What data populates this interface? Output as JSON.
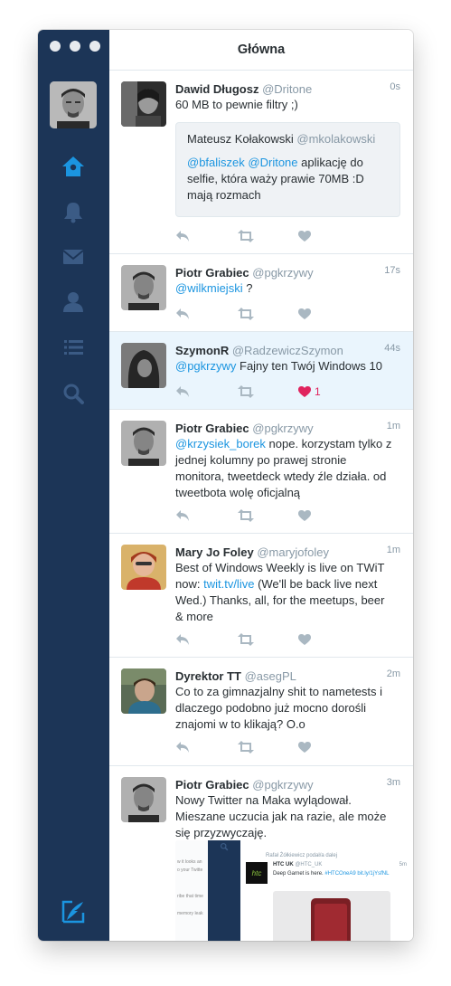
{
  "window": {
    "title": "Główna"
  },
  "colors": {
    "sidebar": "#1c3557",
    "accent": "#1b95e0",
    "like": "#e0245e",
    "highlight": "#eaf5fd"
  },
  "sidebar": {
    "items": [
      {
        "icon": "home-icon",
        "active": true
      },
      {
        "icon": "notifications-bell-icon",
        "active": false
      },
      {
        "icon": "messages-envelope-icon",
        "active": false
      },
      {
        "icon": "profile-person-icon",
        "active": false
      },
      {
        "icon": "lists-icon",
        "active": false
      },
      {
        "icon": "search-icon",
        "active": false
      }
    ],
    "compose_icon": "compose-tweet-icon"
  },
  "tweets": [
    {
      "name": "Dawid Długosz",
      "handle": "@Dritone",
      "time": "0s",
      "text": "60 MB to pewnie filtry ;)",
      "quote": {
        "name": "Mateusz Kołakowski",
        "handle": "@mkolakowski",
        "mention1": "@bfaliszek",
        "mention2": "@Dritone",
        "text": "aplikację do selfie, która waży prawie 70MB :D mają rozmach"
      }
    },
    {
      "name": "Piotr Grabiec",
      "handle": "@pgkrzywy",
      "time": "17s",
      "mention": "@wilkmiejski",
      "text": "?"
    },
    {
      "name": "SzymonR",
      "handle": "@RadzewiczSzymon",
      "time": "44s",
      "mention": "@pgkrzywy",
      "text": "Fajny ten Twój Windows 10",
      "likes": "1",
      "highlighted": true
    },
    {
      "name": "Piotr Grabiec",
      "handle": "@pgkrzywy",
      "time": "1m",
      "mention": "@krzysiek_borek",
      "text_lines": [
        "nope. korzystam tylko z",
        "jednej kolumny po prawej stronie",
        "monitora, tweetdeck wtedy źle działa. od",
        "tweetbota wolę oficjalną"
      ]
    },
    {
      "name": "Mary Jo Foley",
      "handle": "@maryjofoley",
      "time": "1m",
      "text_lines": [
        "Best of Windows Weekly is live on TWiT",
        "now:"
      ],
      "link": "twit.tv/live",
      "text_after_lines": [
        "(We'll be back live next",
        "Wed.) Thanks, all, for the meetups, beer",
        "& more"
      ]
    },
    {
      "name": "Dyrektor TT",
      "handle": "@asegPL",
      "time": "2m",
      "text_lines": [
        "Co to za gimnazjalny shit to nametests i",
        "dlaczego podobno już mocno dorośli",
        "znajomi w to klikają? O.o"
      ]
    },
    {
      "name": "Piotr Grabiec",
      "handle": "@pgkrzywy",
      "time": "3m",
      "text_lines": [
        "Nowy Twitter na Maka wylądował.",
        "Mieszane uczucia jak na razie, ale może",
        "się przyzwyczaję."
      ],
      "screenshot": {
        "left_lines": [
          "w it looks an",
          "o your Twitte",
          "ribe that time",
          "memory leak"
        ],
        "retweet_note": "Rafał Żółkiewicz podał/a dalej",
        "inner_name": "HTC UK",
        "inner_handle": "@HTC_UK",
        "inner_time": "5m",
        "inner_logo": "htc",
        "inner_text": "Deep Garnet is here.",
        "inner_hashtag": "#HTCOneA9",
        "inner_link": "bit.ly/1jYsfNL"
      }
    }
  ]
}
